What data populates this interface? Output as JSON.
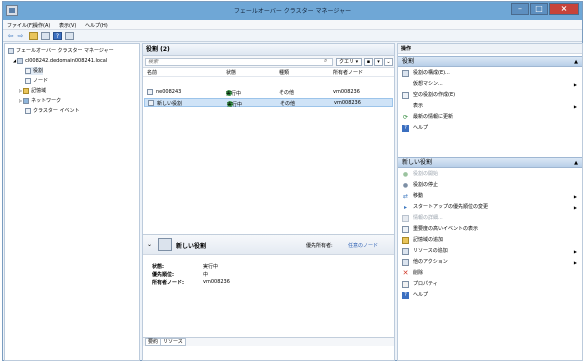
{
  "window": {
    "title": "フェールオーバー クラスター マネージャー",
    "min": "–",
    "max": "□",
    "close": "×"
  },
  "menu": [
    "ファイル(F)",
    "操作(A)",
    "表示(V)",
    "ヘルプ(H)"
  ],
  "toolbar": {
    "back": "⇦",
    "forward": "⇨"
  },
  "tree": {
    "root": "フェールオーバー クラスター マネージャー",
    "cluster": "cl008242.dedomain008241.local",
    "children": [
      "役割",
      "ノード",
      "記憶域",
      "ネットワーク",
      "クラスター イベント"
    ]
  },
  "roles_panel": {
    "title": "役割 (2)",
    "search_placeholder": "検索",
    "query_label": "クエリ",
    "columns": [
      "名前",
      "状態",
      "種類",
      "所有者ノード"
    ],
    "rows": [
      {
        "name": "ne008243",
        "status": "実行中",
        "type": "その他",
        "owner": "vm008236"
      },
      {
        "name": "新しい役割",
        "status": "実行中",
        "type": "その他",
        "owner": "vm008236"
      }
    ]
  },
  "detail": {
    "title": "新しい役割",
    "owner_label": "優先所有者:",
    "owner_link": "任意のノード",
    "fields": [
      {
        "label": "状態:",
        "value": "実行中"
      },
      {
        "label": "優先順位:",
        "value": "中"
      },
      {
        "label": "所有者ノード:",
        "value": "vm008236"
      }
    ],
    "tabs": [
      "要約",
      "リソース"
    ]
  },
  "actions": {
    "header": "操作",
    "section1": {
      "title": "役割",
      "items": [
        {
          "label": "役割の構成(E)...",
          "icon": "configure-icon",
          "arrow": false,
          "disabled": false
        },
        {
          "label": "仮想マシン...",
          "icon": "vm-icon",
          "arrow": true,
          "disabled": false
        },
        {
          "label": "空の役割の作成(E)",
          "icon": "empty-role-icon",
          "arrow": false,
          "disabled": false
        },
        {
          "label": "表示",
          "icon": "",
          "arrow": true,
          "disabled": false
        },
        {
          "label": "最新の情報に更新",
          "icon": "refresh-icon",
          "arrow": false,
          "disabled": false
        },
        {
          "label": "ヘルプ",
          "icon": "help-icon",
          "arrow": false,
          "disabled": false
        }
      ]
    },
    "section2": {
      "title": "新しい役割",
      "items": [
        {
          "label": "役割の開始",
          "icon": "start-icon",
          "arrow": false,
          "disabled": true
        },
        {
          "label": "役割の停止",
          "icon": "stop-icon",
          "arrow": false,
          "disabled": false
        },
        {
          "label": "移動",
          "icon": "move-icon",
          "arrow": true,
          "disabled": false
        },
        {
          "label": "スタートアップの優先順位の変更",
          "icon": "priority-icon",
          "arrow": true,
          "disabled": false
        },
        {
          "label": "情報の詳細...",
          "icon": "info-icon",
          "arrow": false,
          "disabled": true
        },
        {
          "label": "重要度の高いイベントの表示",
          "icon": "events-icon",
          "arrow": false,
          "disabled": false
        },
        {
          "label": "記憶域の追加",
          "icon": "add-storage-icon",
          "arrow": false,
          "disabled": false
        },
        {
          "label": "リソースの追加",
          "icon": "add-resource-icon",
          "arrow": true,
          "disabled": false
        },
        {
          "label": "他のアクション",
          "icon": "more-actions-icon",
          "arrow": true,
          "disabled": false
        },
        {
          "label": "削除",
          "icon": "delete-icon",
          "arrow": false,
          "disabled": false
        },
        {
          "label": "プロパティ",
          "icon": "properties-icon",
          "arrow": false,
          "disabled": false
        },
        {
          "label": "ヘルプ",
          "icon": "help-icon",
          "arrow": false,
          "disabled": false
        }
      ]
    }
  },
  "colors": {
    "titlebar": "#6fa7d6",
    "selection": "#cfe3f7",
    "section": "#b8cfe8",
    "ok": "#3fa34d",
    "delete": "#d23a2a"
  }
}
